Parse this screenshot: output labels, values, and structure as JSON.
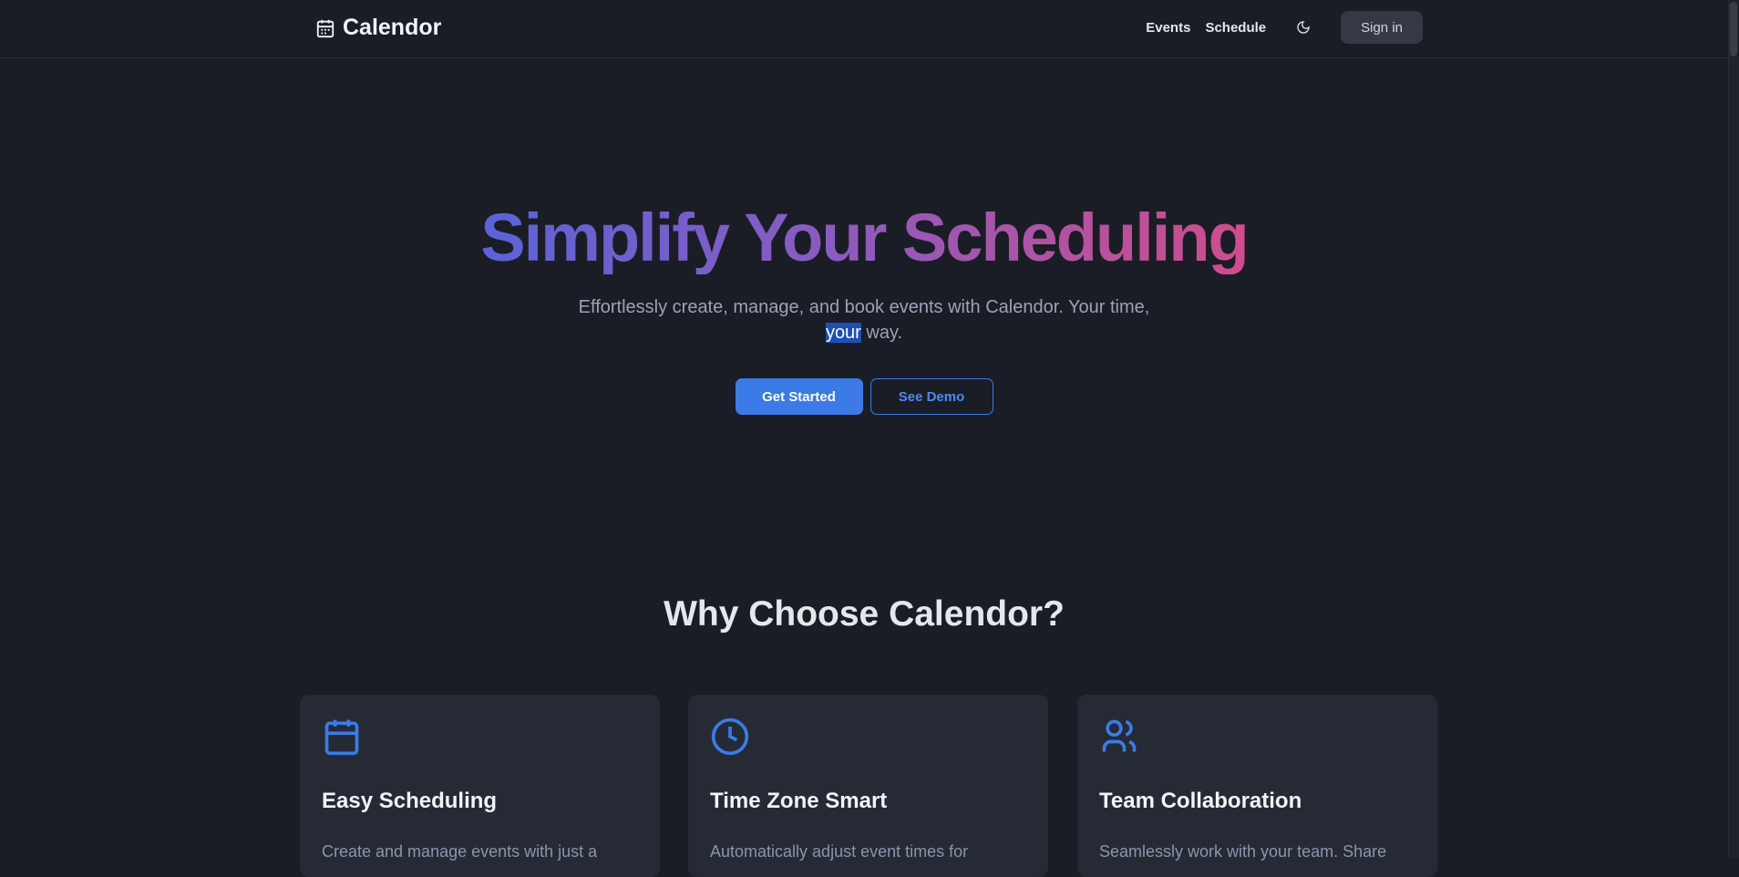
{
  "nav": {
    "brand": "Calendor",
    "links": [
      "Events",
      "Schedule"
    ],
    "theme_toggle": "moon-icon",
    "signin": "Sign in"
  },
  "hero": {
    "title": "Simplify Your Scheduling",
    "subtitle_before": "Effortlessly create, manage, and book events with Calendor. Your time,",
    "subtitle_selected": "your",
    "subtitle_after": " way.",
    "primary": "Get Started",
    "secondary": "See Demo"
  },
  "features": {
    "heading": "Why Choose Calendor?",
    "cards": [
      {
        "icon": "calendar-icon",
        "title": "Easy Scheduling",
        "desc": "Create and manage events with just a"
      },
      {
        "icon": "clock-icon",
        "title": "Time Zone Smart",
        "desc": "Automatically adjust event times for"
      },
      {
        "icon": "users-icon",
        "title": "Team Collaboration",
        "desc": "Seamlessly work with your team. Share"
      }
    ]
  },
  "colors": {
    "accent": "#3b7be8",
    "background": "#1a1d25",
    "card": "#252a35"
  }
}
